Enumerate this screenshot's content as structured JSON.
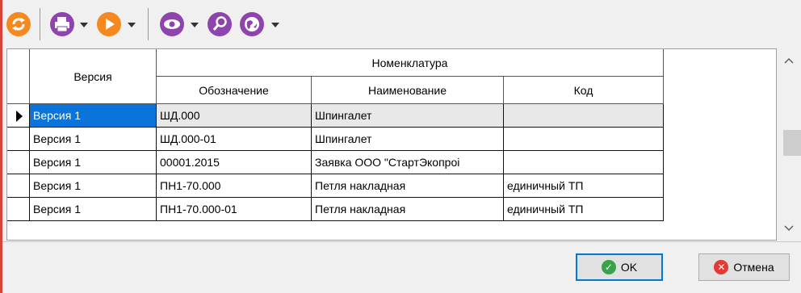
{
  "toolbar": {
    "icons": [
      "refresh-icon",
      "print-icon",
      "play-icon",
      "view-icon",
      "search-icon",
      "globe-icon"
    ],
    "colors": {
      "orange": "#f5891f",
      "purple": "#8e44ad"
    }
  },
  "grid": {
    "group_header": "Номенклатура",
    "columns": {
      "version": "Версия",
      "designation": "Обозначение",
      "name": "Наименование",
      "code": "Код"
    },
    "rows": [
      {
        "version": "Версия 1",
        "designation": "ШД.000",
        "name": "Шпингалет",
        "code": ""
      },
      {
        "version": "Версия 1",
        "designation": "ШД.000-01",
        "name": "Шпингалет",
        "code": ""
      },
      {
        "version": "Версия 1",
        "designation": "00001.2015",
        "name": "Заявка ООО \"СтартЭкопроі",
        "code": ""
      },
      {
        "version": "Версия 1",
        "designation": "ПН1-70.000",
        "name": "Петля накладная",
        "code": "единичный ТП"
      },
      {
        "version": "Версия 1",
        "designation": "ПН1-70.000-01",
        "name": "Петля накладная",
        "code": "единичный ТП"
      }
    ],
    "selection_color": "#0a74da"
  },
  "buttons": {
    "ok": "OK",
    "cancel": "Отмена"
  }
}
